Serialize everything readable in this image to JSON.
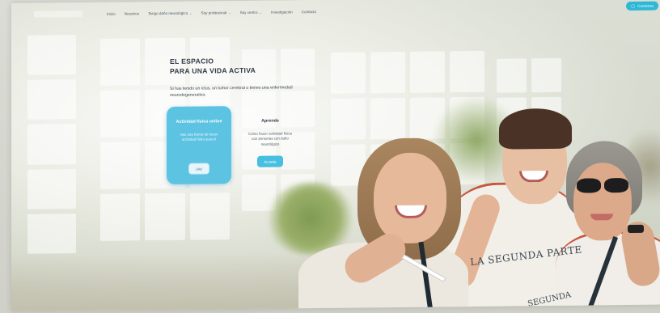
{
  "nav": {
    "items": [
      {
        "label": "Inicio",
        "has_dropdown": false
      },
      {
        "label": "Nosotros",
        "has_dropdown": false
      },
      {
        "label": "Tengo daño neurológico",
        "has_dropdown": true
      },
      {
        "label": "Soy profesional",
        "has_dropdown": true
      },
      {
        "label": "Soy centro",
        "has_dropdown": true
      },
      {
        "label": "Investigación",
        "has_dropdown": false
      },
      {
        "label": "Contacto",
        "has_dropdown": false
      }
    ],
    "cta_label": "Comienza"
  },
  "hero": {
    "title_line1": "EL ESPACIO",
    "title_line2": "PARA UNA VIDA ACTIVA",
    "text": "Si has tenido un ictus, un tumor cerebral o tienes una enfermedad neurodegenerativa."
  },
  "cards": [
    {
      "title": "Actividad física online",
      "text": "Haz una forma de hacer actividad física para ti",
      "button": "¡Ve!"
    },
    {
      "title": "Aprende",
      "text": "Cómo hacer actividad física con personas con daño neurológico",
      "button": "Accede"
    }
  ],
  "photo": {
    "shirt_text": "LA SEGUNDA PARTE",
    "shirt_text_2": "SEGUNDA"
  },
  "colors": {
    "accent": "#2fb8d6",
    "card_primary": "#5dc3e2",
    "text_dark": "#2f3a44"
  }
}
